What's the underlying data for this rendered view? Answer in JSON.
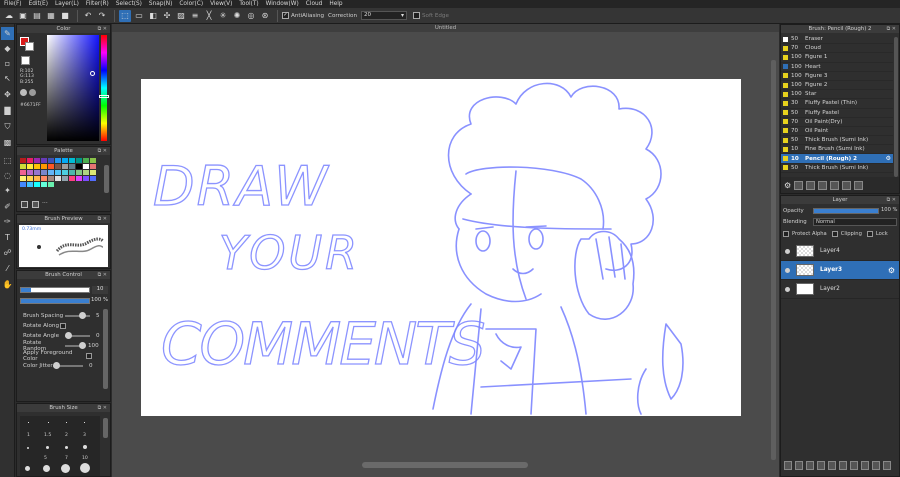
{
  "menu": [
    "File(F)",
    "Edit(E)",
    "Layer(L)",
    "Filter(R)",
    "Select(S)",
    "Snap(N)",
    "Color(C)",
    "View(V)",
    "Tool(T)",
    "Window(W)",
    "Cloud",
    "Help"
  ],
  "toolbar": {
    "antialiasing_label": "AntiAliasing",
    "correction_label": "Correction",
    "correction_value": "20",
    "soft_edge_label": "Soft Edge"
  },
  "color_panel": {
    "title": "Color",
    "r": "R:102",
    "g": "G:113",
    "b": "B:255",
    "hex": "#6671FF",
    "current_color": "#6671ff"
  },
  "palette": {
    "title": "Palette"
  },
  "brush_preview": {
    "title": "Brush Preview",
    "size_label": "0.73mm"
  },
  "brush_control": {
    "title": "Brush Control",
    "size_value": "10",
    "opacity_value": "100 %",
    "rows": [
      {
        "label": "Brush Spacing",
        "value": "5"
      },
      {
        "label": "Rotate Along",
        "value": ""
      },
      {
        "label": "Rotate Angle",
        "value": "0"
      },
      {
        "label": "Rotate Random",
        "value": "100"
      },
      {
        "label": "Apply Foreground Color",
        "value": ""
      },
      {
        "label": "Color Jitter",
        "value": "0"
      }
    ]
  },
  "brush_size": {
    "title": "Brush Size",
    "labels": [
      "1",
      "1.5",
      "2",
      "3",
      "5",
      "7",
      "10"
    ]
  },
  "document": {
    "title": "Untitled"
  },
  "canvas_text": {
    "line1": "DRAW",
    "line2": "YOUR",
    "line3": "COMMENTS"
  },
  "brush_panel": {
    "title": "Brush: Pencil (Rough) 2",
    "items": [
      {
        "size": "50",
        "name": "Eraser",
        "color": "#ffffff"
      },
      {
        "size": "70",
        "name": "Cloud",
        "color": "#e7d21d"
      },
      {
        "size": "100",
        "name": "Figure 1",
        "color": "#e7d21d"
      },
      {
        "size": "100",
        "name": "Heart",
        "color": "#2f6fb6"
      },
      {
        "size": "100",
        "name": "Figure 3",
        "color": "#e7d21d"
      },
      {
        "size": "100",
        "name": "Figure 2",
        "color": "#e7d21d"
      },
      {
        "size": "100",
        "name": "Star",
        "color": "#e7d21d"
      },
      {
        "size": "30",
        "name": "Fluffy Pastel (Thin)",
        "color": "#e7d21d"
      },
      {
        "size": "50",
        "name": "Fluffy Pastel",
        "color": "#e7d21d"
      },
      {
        "size": "70",
        "name": "Oil Paint(Dry)",
        "color": "#e7d21d"
      },
      {
        "size": "70",
        "name": "Oil Paint",
        "color": "#e7d21d"
      },
      {
        "size": "50",
        "name": "Thick Brush (Sumi Ink)",
        "color": "#e7d21d"
      },
      {
        "size": "10",
        "name": "Fine Brush (Sumi Ink)",
        "color": "#e7d21d"
      },
      {
        "size": "10",
        "name": "Pencil (Rough) 2",
        "color": "#e7d21d",
        "selected": true
      },
      {
        "size": "50",
        "name": "Thick Brush (Sumi Ink)",
        "color": "#e7d21d"
      }
    ]
  },
  "layer_panel": {
    "title": "Layer",
    "opacity_label": "Opacity",
    "opacity_value": "100 %",
    "blending_label": "Blending",
    "blending_value": "Normal",
    "protect_alpha": "Protect Alpha",
    "clipping": "Clipping",
    "lock": "Lock",
    "layers": [
      {
        "name": "Layer4",
        "selected": false
      },
      {
        "name": "Layer3",
        "selected": true
      },
      {
        "name": "Layer2",
        "selected": false
      }
    ]
  },
  "accent": "#2f6fb6",
  "sketch_color": "#6671ff"
}
